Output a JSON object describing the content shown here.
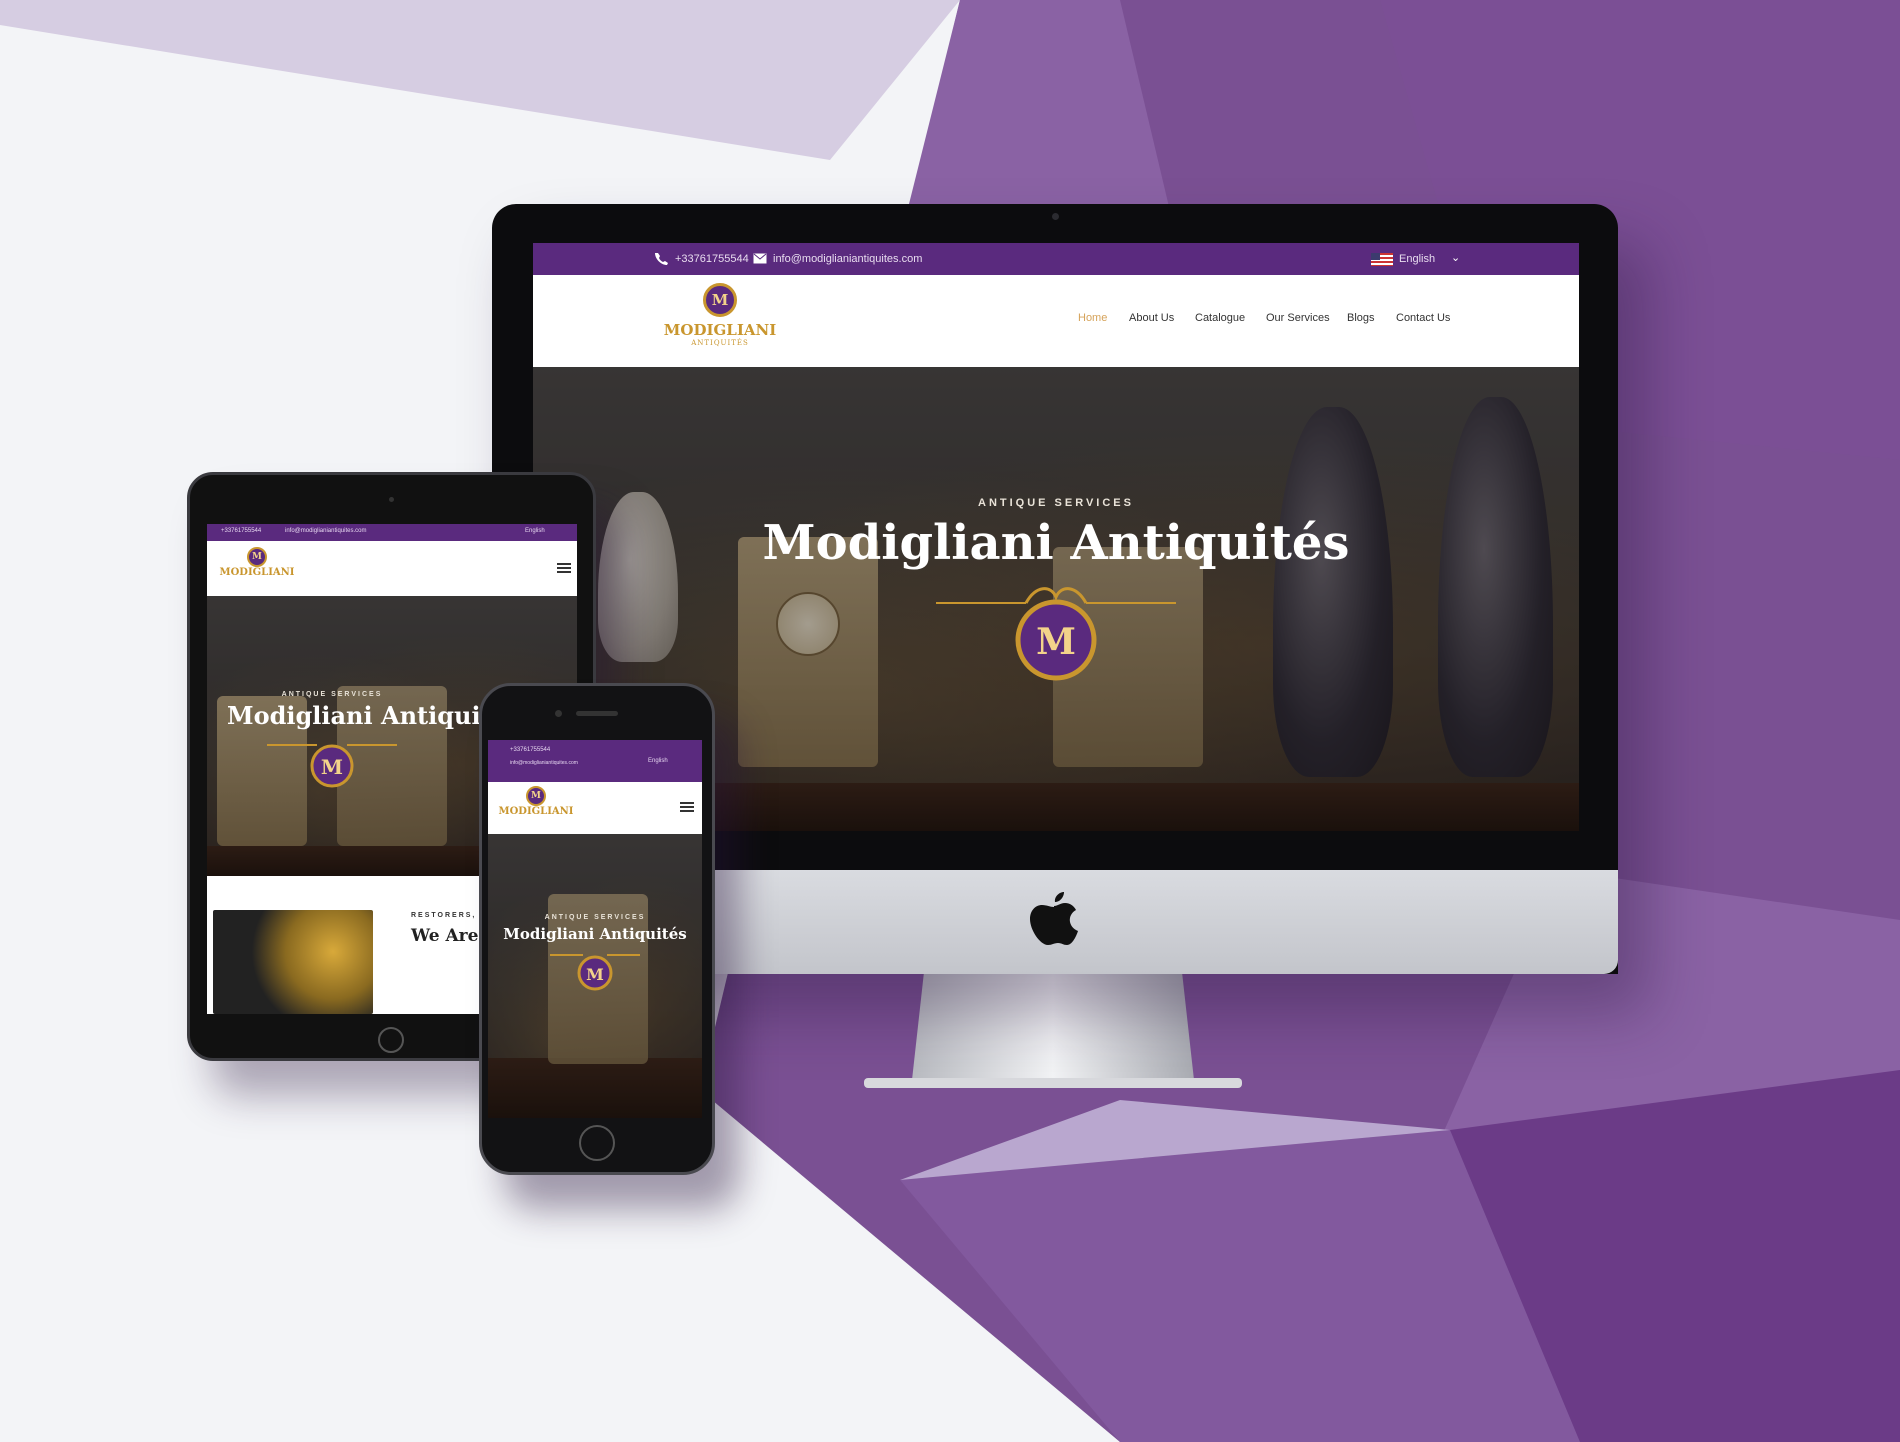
{
  "background": {
    "colors": [
      "#f3f4f7",
      "#d6cde2",
      "#8a62a4",
      "#7a5093",
      "#6b3b87",
      "#b9a7cf"
    ]
  },
  "site": {
    "phone": "+33761755544",
    "email": "info@modiglianiantiquites.com",
    "language": "English",
    "logo": {
      "name": "MODIGLIANI",
      "sub": "ANTIQUITÉS",
      "monogram": "M"
    },
    "nav": [
      {
        "label": "Home",
        "active": true
      },
      {
        "label": "About Us"
      },
      {
        "label": "Catalogue"
      },
      {
        "label": "Our Services"
      },
      {
        "label": "Blogs"
      },
      {
        "label": "Contact Us"
      }
    ],
    "hero": {
      "kicker": "ANTIQUE SERVICES",
      "title": "Modigliani Antiquités"
    },
    "section2": {
      "kicker": "RESTORERS, S",
      "title": "We Are F"
    },
    "brand_purple": "#5a2a7e",
    "gold": "#c9962e"
  },
  "devices": [
    "imac",
    "ipad",
    "iphone"
  ]
}
